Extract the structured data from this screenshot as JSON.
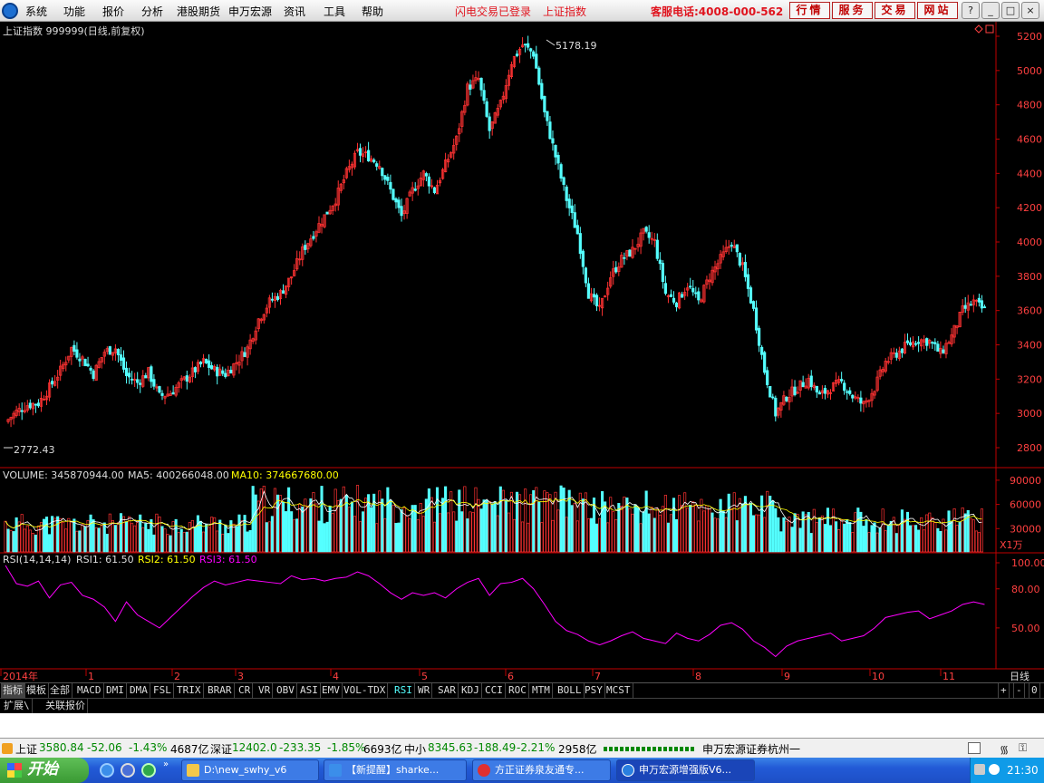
{
  "menu": [
    "系统",
    "功能",
    "报价",
    "分析",
    "港股期货",
    "申万宏源",
    "资讯",
    "工具",
    "帮助"
  ],
  "status": {
    "login": "闪电交易已登录",
    "index": "上证指数"
  },
  "hotline": "客服电话:4008-000-562",
  "top_buttons": [
    "行情",
    "服务",
    "交易",
    "网站"
  ],
  "window_buttons": [
    "?",
    "_",
    "□",
    "×"
  ],
  "chart_title": "上证指数 999999(日线,前复权)",
  "colors": {
    "up": "#ff3232",
    "down": "#54ffff",
    "ma5": "#ffffff",
    "ma10": "#ffff00",
    "rsi": "#ff00ff",
    "axis": "#c00000"
  },
  "chart_data": {
    "type": "candlestick",
    "high_label": "5178.19",
    "low_label": "2772.43",
    "price_ticks": [
      "5200",
      "5000",
      "4800",
      "4600",
      "4400",
      "4200",
      "4000",
      "3800",
      "3600",
      "3400",
      "3200",
      "3000",
      "2800"
    ],
    "months": [
      "2014年",
      "1",
      "2",
      "3",
      "4",
      "5",
      "6",
      "7",
      "8",
      "9",
      "10",
      "11"
    ],
    "period": "日线",
    "volume": {
      "label": "VOLUME: 345870944.00",
      "ma5": "MA5: 400266048.00",
      "ma10": "MA10: 374667680.00",
      "ticks": [
        "90000",
        "60000",
        "30000"
      ],
      "unit": "X1万"
    },
    "rsi": {
      "label": "RSI(14,14,14)",
      "rsi1": "RSI1: 61.50",
      "rsi2": "RSI2: 61.50",
      "rsi3": "RSI3: 61.50",
      "ticks": [
        "100.00",
        "80.00",
        "50.00"
      ]
    },
    "close_path": [
      [
        0,
        2950
      ],
      [
        4,
        3010
      ],
      [
        8,
        3050
      ],
      [
        12,
        3060
      ],
      [
        16,
        3150
      ],
      [
        20,
        3250
      ],
      [
        24,
        3380
      ],
      [
        28,
        3320
      ],
      [
        32,
        3230
      ],
      [
        36,
        3360
      ],
      [
        40,
        3380
      ],
      [
        44,
        3220
      ],
      [
        48,
        3180
      ],
      [
        52,
        3240
      ],
      [
        56,
        3100
      ],
      [
        60,
        3120
      ],
      [
        64,
        3180
      ],
      [
        68,
        3240
      ],
      [
        72,
        3300
      ],
      [
        76,
        3250
      ],
      [
        80,
        3230
      ],
      [
        84,
        3300
      ],
      [
        88,
        3380
      ],
      [
        92,
        3550
      ],
      [
        96,
        3650
      ],
      [
        100,
        3700
      ],
      [
        104,
        3800
      ],
      [
        108,
        3950
      ],
      [
        112,
        4050
      ],
      [
        116,
        4150
      ],
      [
        120,
        4250
      ],
      [
        124,
        4400
      ],
      [
        128,
        4520
      ],
      [
        132,
        4500
      ],
      [
        136,
        4450
      ],
      [
        140,
        4300
      ],
      [
        144,
        4150
      ],
      [
        148,
        4300
      ],
      [
        152,
        4400
      ],
      [
        156,
        4300
      ],
      [
        160,
        4450
      ],
      [
        164,
        4600
      ],
      [
        168,
        4900
      ],
      [
        172,
        4950
      ],
      [
        176,
        4650
      ],
      [
        180,
        4800
      ],
      [
        184,
        5050
      ],
      [
        188,
        5150
      ],
      [
        192,
        5100
      ],
      [
        196,
        4750
      ],
      [
        200,
        4500
      ],
      [
        204,
        4250
      ],
      [
        208,
        4050
      ],
      [
        212,
        3700
      ],
      [
        216,
        3600
      ],
      [
        220,
        3800
      ],
      [
        224,
        3900
      ],
      [
        228,
        3950
      ],
      [
        232,
        4050
      ],
      [
        236,
        4000
      ],
      [
        240,
        3700
      ],
      [
        244,
        3650
      ],
      [
        248,
        3750
      ],
      [
        252,
        3650
      ],
      [
        256,
        3800
      ],
      [
        260,
        3900
      ],
      [
        264,
        4000
      ],
      [
        268,
        3850
      ],
      [
        272,
        3600
      ],
      [
        276,
        3250
      ],
      [
        280,
        3000
      ],
      [
        284,
        3100
      ],
      [
        288,
        3150
      ],
      [
        292,
        3200
      ],
      [
        296,
        3100
      ],
      [
        300,
        3150
      ],
      [
        304,
        3180
      ],
      [
        308,
        3100
      ],
      [
        312,
        3050
      ],
      [
        316,
        3150
      ],
      [
        320,
        3300
      ],
      [
        324,
        3350
      ],
      [
        328,
        3400
      ],
      [
        332,
        3430
      ],
      [
        336,
        3420
      ],
      [
        340,
        3350
      ],
      [
        344,
        3450
      ],
      [
        348,
        3600
      ],
      [
        352,
        3650
      ],
      [
        356,
        3600
      ]
    ],
    "rsi_path": [
      [
        0,
        98
      ],
      [
        4,
        84
      ],
      [
        8,
        82
      ],
      [
        12,
        86
      ],
      [
        16,
        73
      ],
      [
        20,
        83
      ],
      [
        24,
        85
      ],
      [
        28,
        75
      ],
      [
        32,
        72
      ],
      [
        36,
        66
      ],
      [
        40,
        55
      ],
      [
        44,
        70
      ],
      [
        48,
        60
      ],
      [
        52,
        55
      ],
      [
        56,
        50
      ],
      [
        60,
        58
      ],
      [
        64,
        66
      ],
      [
        68,
        74
      ],
      [
        72,
        81
      ],
      [
        76,
        86
      ],
      [
        80,
        83
      ],
      [
        84,
        85
      ],
      [
        88,
        87
      ],
      [
        92,
        86
      ],
      [
        96,
        85
      ],
      [
        100,
        84
      ],
      [
        104,
        90
      ],
      [
        108,
        87
      ],
      [
        112,
        88
      ],
      [
        116,
        86
      ],
      [
        120,
        88
      ],
      [
        124,
        89
      ],
      [
        128,
        93
      ],
      [
        132,
        90
      ],
      [
        136,
        84
      ],
      [
        140,
        77
      ],
      [
        144,
        72
      ],
      [
        148,
        77
      ],
      [
        152,
        75
      ],
      [
        156,
        77
      ],
      [
        160,
        73
      ],
      [
        164,
        80
      ],
      [
        168,
        85
      ],
      [
        172,
        88
      ],
      [
        176,
        75
      ],
      [
        180,
        84
      ],
      [
        184,
        85
      ],
      [
        188,
        88
      ],
      [
        192,
        80
      ],
      [
        196,
        68
      ],
      [
        200,
        55
      ],
      [
        204,
        48
      ],
      [
        208,
        45
      ],
      [
        212,
        40
      ],
      [
        216,
        37
      ],
      [
        220,
        40
      ],
      [
        224,
        44
      ],
      [
        228,
        47
      ],
      [
        232,
        42
      ],
      [
        236,
        40
      ],
      [
        240,
        38
      ],
      [
        244,
        46
      ],
      [
        248,
        42
      ],
      [
        252,
        40
      ],
      [
        256,
        45
      ],
      [
        260,
        52
      ],
      [
        264,
        54
      ],
      [
        268,
        49
      ],
      [
        272,
        40
      ],
      [
        276,
        35
      ],
      [
        280,
        28
      ],
      [
        284,
        36
      ],
      [
        288,
        40
      ],
      [
        292,
        42
      ],
      [
        296,
        44
      ],
      [
        300,
        46
      ],
      [
        304,
        40
      ],
      [
        308,
        42
      ],
      [
        312,
        44
      ],
      [
        316,
        50
      ],
      [
        320,
        58
      ],
      [
        324,
        60
      ],
      [
        328,
        62
      ],
      [
        332,
        63
      ],
      [
        336,
        57
      ],
      [
        340,
        60
      ],
      [
        344,
        63
      ],
      [
        348,
        68
      ],
      [
        352,
        70
      ],
      [
        356,
        68
      ]
    ]
  },
  "indicator_tabs": [
    "指标",
    "模板",
    "全部",
    "MACD",
    "DMI",
    "DMA",
    "FSL",
    "TRIX",
    "BRAR",
    "CR",
    "VR",
    "OBV",
    "ASI",
    "EMV",
    "VOL-TDX",
    "RSI",
    "WR",
    "SAR",
    "KDJ",
    "CCI",
    "ROC",
    "MTM",
    "BOLL",
    "PSY",
    "MCST"
  ],
  "tab_controls": [
    "+",
    "-",
    "0"
  ],
  "sub_tabs": [
    "扩展\\",
    "关联报价"
  ],
  "quotes": [
    {
      "name": "上证",
      "value": "3580.84",
      "change": "-52.06",
      "pct": "-1.43%",
      "amount": "4687亿"
    },
    {
      "name": "深证",
      "value": "12402.0",
      "change": "-233.35",
      "pct": "-1.85%",
      "amount": "6693亿"
    },
    {
      "name": "中小",
      "value": "8345.63",
      "change": "-188.49",
      "pct": "-2.21%",
      "amount": "2958亿"
    }
  ],
  "broker": "申万宏源证券杭州一",
  "taskbar": {
    "start": "开始",
    "tasks": [
      "D:\\new_swhy_v6",
      "【新提醒】sharke...",
      "方正证券泉友通专...",
      "申万宏源增强版V6..."
    ],
    "time": "21:30"
  }
}
